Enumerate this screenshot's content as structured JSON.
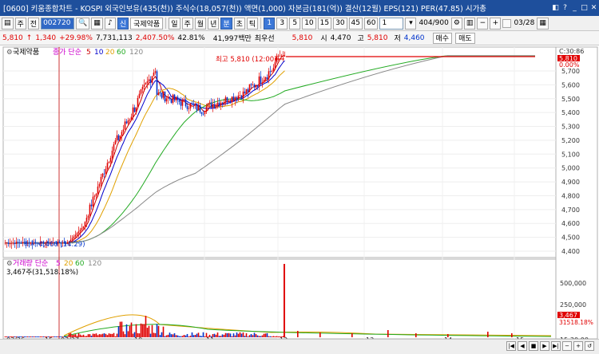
{
  "window": {
    "title": "[0600] 키움종합차트 - KOSPI 외국인보유(435(천)) 주식수(18,057(천)) 액면(1,000) 자본금(181(억)) 결산(12월) EPS(121) PER(47.85) 시가총",
    "buttons": [
      "▫",
      "◧",
      "▭",
      "✕",
      "?",
      "_",
      "□",
      "X"
    ]
  },
  "toolbar": {
    "period": "주",
    "prev_label": "전",
    "code": "002720",
    "stock_badge": "신",
    "stock_name": "국제약품",
    "intervals": [
      "일",
      "주",
      "월",
      "년",
      "분",
      "초",
      "틱"
    ],
    "minute_options": [
      "1",
      "3",
      "5",
      "10",
      "15",
      "30",
      "45",
      "60"
    ],
    "selected_minute": "1",
    "count_select": "1",
    "view_count": "404/900",
    "date": "03/28"
  },
  "quote": {
    "price": "5,810",
    "arrow": "↑",
    "change": "1,340",
    "change_rate": "+29.98%",
    "volume": "7,731,113",
    "volume_rate": "2,407.50%",
    "turnover": "42.81%",
    "amount": "41,997백만",
    "priority": "최우선",
    "ask": "5,810",
    "open_label": "시",
    "open": "4,470",
    "high_label": "고",
    "high": "5,810",
    "low_label": "저",
    "low": "4,460",
    "buy": "매수",
    "sell": "매도"
  },
  "price_pane": {
    "stock_label": "국제약품",
    "ma_label_prefix": "종가 단순",
    "ma_periods": [
      "5",
      "10",
      "20",
      "60",
      "120"
    ],
    "ma_colors": [
      "#cc0000",
      "#0000cc",
      "#e0a000",
      "#22aa22",
      "#888888"
    ],
    "high_annotation": "최고 5,810 (12:00)",
    "low_annotation": "최저 4,460 (14:29)",
    "time_label": "C:30:86",
    "last_price": "5,810",
    "last_change": "0.00%",
    "y_ticks": [
      "5,700",
      "5,600",
      "5,500",
      "5,400",
      "5,300",
      "5,200",
      "5,100",
      "5,000",
      "4,900",
      "4,800",
      "4,700",
      "4,600",
      "4,500",
      "4,400"
    ],
    "colors": {
      "up": "#e00000",
      "down": "#0033cc"
    }
  },
  "volume_pane": {
    "label_prefix": "거래량 단순",
    "ma_periods": [
      "5",
      "20",
      "60",
      "120"
    ],
    "current": "3,467주(31,518.18%)",
    "y_ticks": [
      "500,000",
      "250,000"
    ],
    "last_volume": "3,467",
    "last_rate": "31518.18%"
  },
  "x_axis": {
    "ticks": [
      "03/26",
      "15",
      "03/27",
      "10",
      "11",
      "12",
      "13",
      "14",
      "15"
    ],
    "end_time": "15:30:00"
  },
  "chart_data": {
    "type": "candlestick",
    "x": [
      "03/26 15:00",
      "03/27 09:00",
      "10:00",
      "11:00",
      "12:00",
      "13:00",
      "14:00",
      "15:00"
    ],
    "price_ylim": [
      4400,
      5810
    ],
    "open": 4470,
    "high": 5810,
    "low": 4460,
    "close": 5810,
    "volume_ylim": [
      0,
      600000
    ]
  }
}
